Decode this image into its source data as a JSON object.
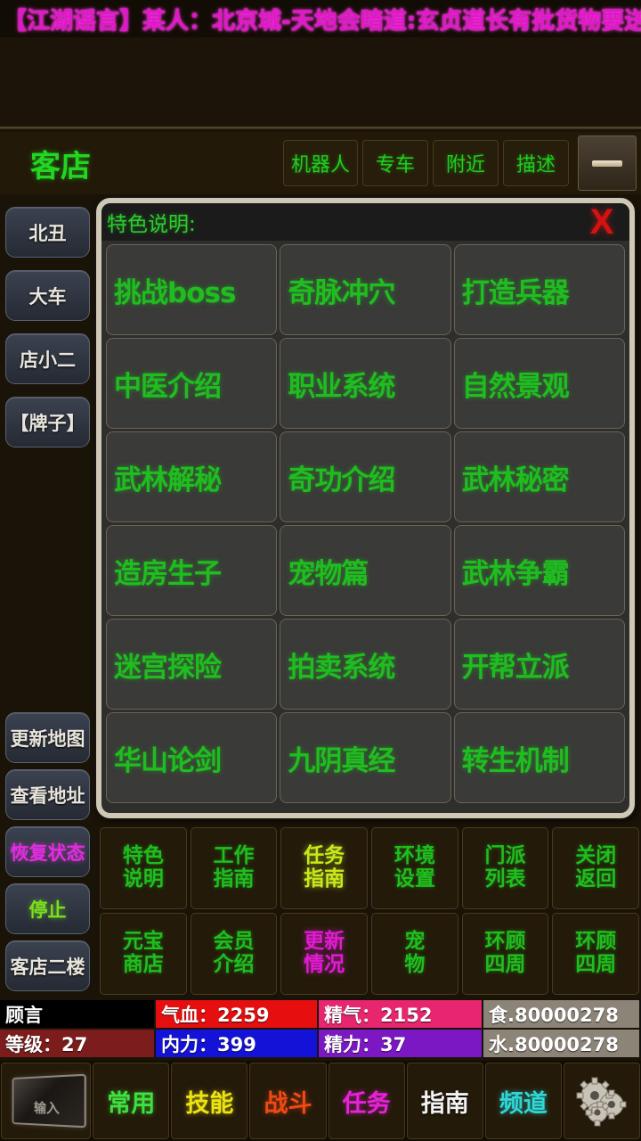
{
  "banner": {
    "text": "【江湖谣言】某人：北京城-天地会暗道:玄贞道长有批货物要送到",
    "color": "#e018c8"
  },
  "header": {
    "title": "客店",
    "buttons": [
      {
        "label": "机器人"
      },
      {
        "label": "专车"
      },
      {
        "label": "附近"
      },
      {
        "label": "描述"
      }
    ],
    "minimize_icon": "minimize-icon"
  },
  "sidebar": {
    "top_items": [
      {
        "label": "北丑"
      },
      {
        "label": "大车"
      },
      {
        "label": "店小二"
      },
      {
        "label": "【牌子】"
      }
    ],
    "bottom_items": [
      {
        "label": "更新地图",
        "style": "plain"
      },
      {
        "label": "查看地址",
        "style": "plain"
      },
      {
        "label": "恢复状态",
        "style": "magenta"
      },
      {
        "label": "停止",
        "style": "green"
      },
      {
        "label": "客店二楼",
        "style": "plain"
      }
    ]
  },
  "modal": {
    "title": "特色说明:",
    "close_label": "X",
    "close_color": "#d61111",
    "items": [
      {
        "label": "挑战boss"
      },
      {
        "label": "奇脉冲穴"
      },
      {
        "label": "打造兵器"
      },
      {
        "label": "中医介绍"
      },
      {
        "label": "职业系统"
      },
      {
        "label": "自然景观"
      },
      {
        "label": "武林解秘"
      },
      {
        "label": "奇功介绍"
      },
      {
        "label": "武林秘密"
      },
      {
        "label": "造房生子"
      },
      {
        "label": "宠物篇"
      },
      {
        "label": "武林争霸"
      },
      {
        "label": "迷宫探险"
      },
      {
        "label": "拍卖系统"
      },
      {
        "label": "开帮立派"
      },
      {
        "label": "华山论剑"
      },
      {
        "label": "九阴真经"
      },
      {
        "label": "转生机制"
      }
    ]
  },
  "commands": {
    "row1": [
      {
        "line1": "特色",
        "line2": "说明",
        "style": "normal"
      },
      {
        "line1": "工作",
        "line2": "指南",
        "style": "normal"
      },
      {
        "line1": "任务",
        "line2": "指南",
        "style": "hl"
      },
      {
        "line1": "环境",
        "line2": "设置",
        "style": "normal"
      },
      {
        "line1": "门派",
        "line2": "列表",
        "style": "normal"
      },
      {
        "line1": "关闭",
        "line2": "返回",
        "style": "normal"
      }
    ],
    "row2": [
      {
        "line1": "元宝",
        "line2": "商店",
        "style": "normal"
      },
      {
        "line1": "会员",
        "line2": "介绍",
        "style": "normal"
      },
      {
        "line1": "更新",
        "line2": "情况",
        "style": "mag"
      },
      {
        "line1": "宠",
        "line2": "物",
        "style": "normal"
      },
      {
        "line1": "环顾",
        "line2": "四周",
        "style": "normal"
      },
      {
        "line1": "环顾",
        "line2": "四周",
        "style": "normal"
      }
    ]
  },
  "status": {
    "row1": [
      {
        "text": "顾言",
        "bg": "#000000",
        "w": 175
      },
      {
        "text": "气血：2259",
        "bg": "#e60e0e",
        "w": 183
      },
      {
        "text": "精气：2152",
        "bg": "#e8256f",
        "w": 185
      },
      {
        "text": "食.80000278",
        "bg": "#8c8477",
        "w": 177
      }
    ],
    "row2": [
      {
        "text": "等级：27",
        "bg": "#7c1c1c",
        "w": 175
      },
      {
        "text": "内力：399",
        "bg": "#1512d8",
        "w": 183
      },
      {
        "text": "精力：37",
        "bg": "#7b18c4",
        "w": 185
      },
      {
        "text": "水.80000278",
        "bg": "#8c8477",
        "w": 177
      }
    ]
  },
  "navbar": {
    "input_icon": "text-input-icon",
    "input_placeholder": "输入",
    "items": [
      {
        "label": "常用",
        "style": "c-green"
      },
      {
        "label": "技能",
        "style": "c-yellow"
      },
      {
        "label": "战斗",
        "style": "c-orange"
      },
      {
        "label": "任务",
        "style": "c-magenta"
      },
      {
        "label": "指南",
        "style": "c-white"
      },
      {
        "label": "频道",
        "style": "c-cyan"
      }
    ],
    "settings_icon": "gears-icon"
  }
}
